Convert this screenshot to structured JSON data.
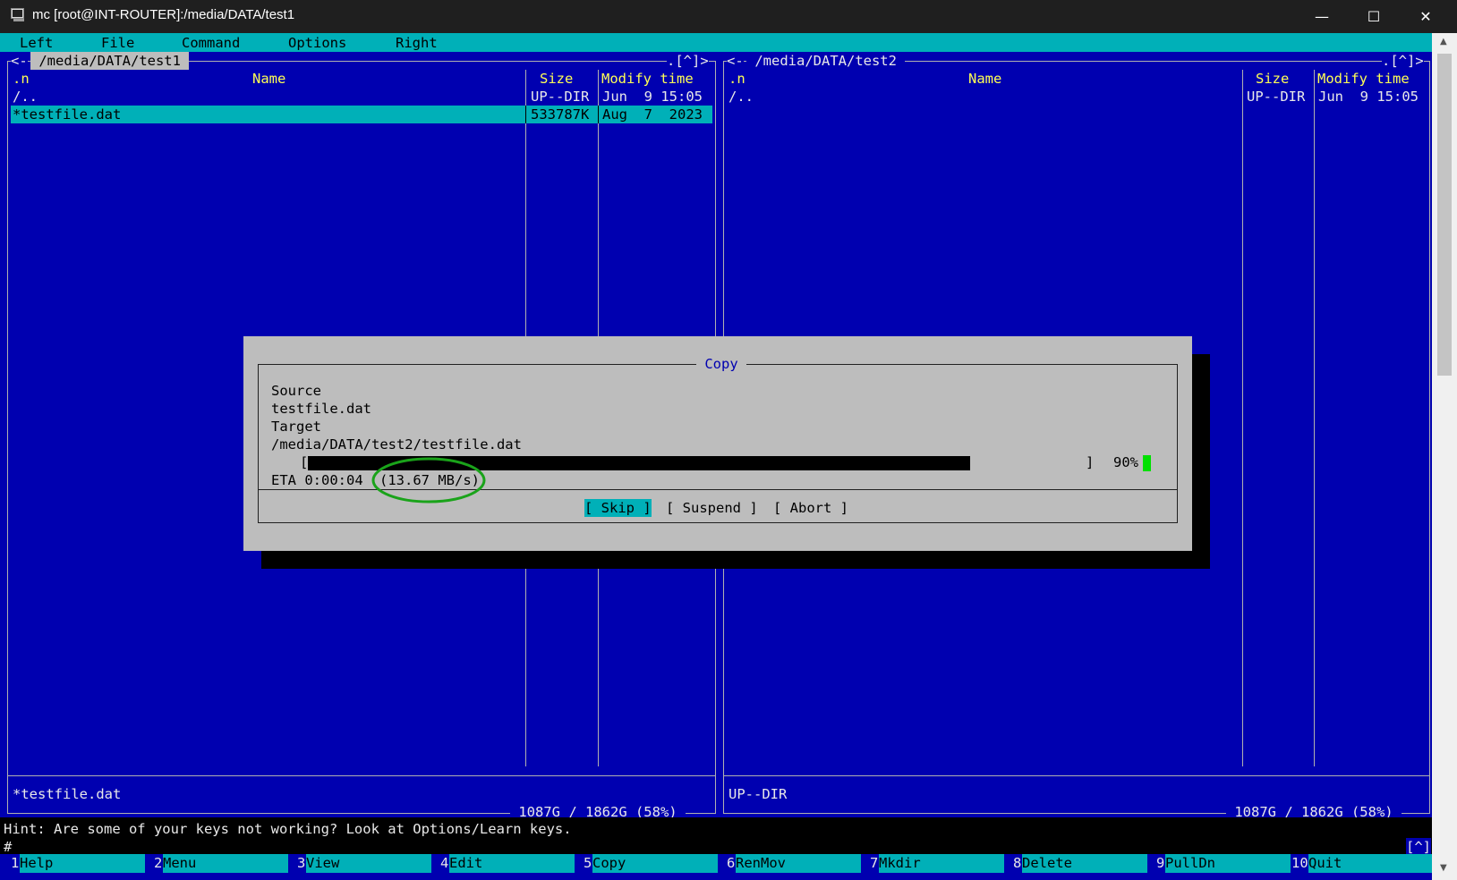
{
  "window": {
    "title": "mc [root@INT-ROUTER]:/media/DATA/test1",
    "minimize": "—",
    "maximize": "☐",
    "close": "✕"
  },
  "menu": [
    "Left",
    "File",
    "Command",
    "Options",
    "Right"
  ],
  "left_panel": {
    "path": " /media/DATA/test1 ",
    "corner_left": "<-",
    "corner_right": ".[^]>",
    "col_sort": ".n",
    "col_name": "Name",
    "col_size": "Size",
    "col_time": "Modify time",
    "rows": [
      {
        "name": "/..",
        "size": "UP--DIR",
        "time": "Jun  9 15:05"
      },
      {
        "name": "*testfile.dat",
        "size": "533787K",
        "time": "Aug  7  2023"
      }
    ],
    "status": "*testfile.dat",
    "disk": " 1087G / 1862G (58%) "
  },
  "right_panel": {
    "path": " /media/DATA/test2 ",
    "corner_left": "<-",
    "corner_right": ".[^]>",
    "col_sort": ".n",
    "col_name": "Name",
    "col_size": "Size",
    "col_time": "Modify time",
    "rows": [
      {
        "name": "/..",
        "size": "UP--DIR",
        "time": "Jun  9 15:05"
      }
    ],
    "status": "UP--DIR",
    "disk": " 1087G / 1862G (58%) "
  },
  "dialog": {
    "title": " Copy ",
    "source_label": "Source",
    "source_value": "testfile.dat",
    "target_label": "Target",
    "target_value": "/media/DATA/test2/testfile.dat",
    "bar_open": "[",
    "bar_close": "]",
    "progress_text": "90%",
    "progress_fraction": 0.9,
    "eta": "ETA 0:00:04",
    "speed": "(13.67 MB/s)",
    "buttons": {
      "skip": "[ Skip ]",
      "suspend": "[ Suspend ]",
      "abort": "[ Abort ]"
    }
  },
  "hint": "Hint: Are some of your keys not working? Look at Options/Learn keys.",
  "prompt": "#",
  "prompt_corner": "[^]",
  "fkeys": [
    {
      "num": "1",
      "label": "Help"
    },
    {
      "num": "2",
      "label": "Menu"
    },
    {
      "num": "3",
      "label": "View"
    },
    {
      "num": "4",
      "label": "Edit"
    },
    {
      "num": "5",
      "label": "Copy"
    },
    {
      "num": "6",
      "label": "RenMov"
    },
    {
      "num": "7",
      "label": "Mkdir"
    },
    {
      "num": "8",
      "label": "Delete"
    },
    {
      "num": "9",
      "label": "PullDn"
    },
    {
      "num": "10",
      "label": "Quit"
    }
  ],
  "colors": {
    "panel_bg": "#0000b0",
    "cyan": "#00b0b8",
    "dialog_bg": "#bdbdbd",
    "highlight_ring": "#1aa31a",
    "progress_end": "#00e000"
  }
}
